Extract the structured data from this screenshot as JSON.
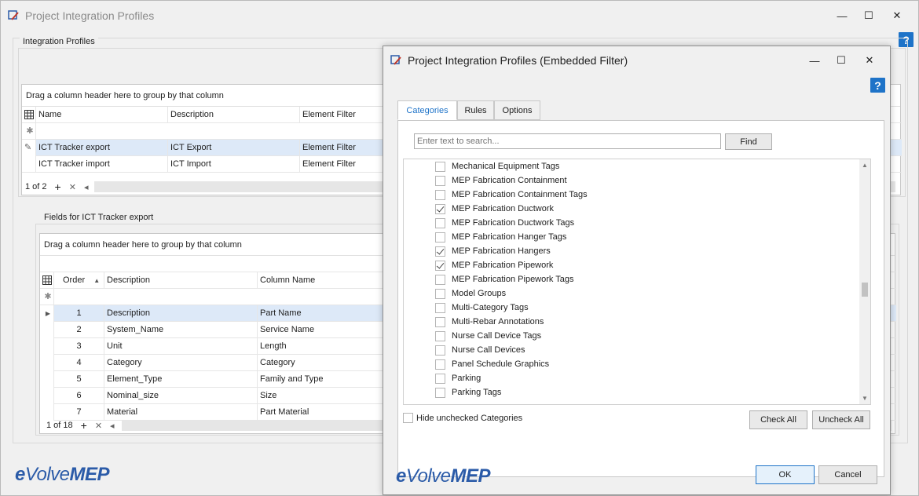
{
  "main_window": {
    "title": "Project Integration Profiles",
    "controls": {
      "minimize": "—",
      "maximize": "☐",
      "close": "✕"
    },
    "help": "?",
    "integration_profiles": {
      "group_label": "Integration Profiles",
      "group_panel_text": "Drag a column header here to group by that column",
      "columns": [
        "Name",
        "Description",
        "Element Filter"
      ],
      "rows": [
        {
          "name": "ICT Tracker export",
          "description": "ICT Export",
          "filter": "Element Filter"
        },
        {
          "name": "ICT Tracker import",
          "description": "ICT Import",
          "filter": "Element Filter"
        }
      ],
      "nav_text": "1 of 2",
      "nav_add": "+",
      "nav_delete": "✕",
      "nav_left": "◂"
    },
    "fields": {
      "group_label": "Fields for ICT Tracker export",
      "group_panel_text": "Drag a column header here to group by that column",
      "columns": [
        "Order",
        "Description",
        "Column Name"
      ],
      "rows": [
        {
          "order": "1",
          "description": "Description",
          "column": "Part Name"
        },
        {
          "order": "2",
          "description": "System_Name",
          "column": "Service Name"
        },
        {
          "order": "3",
          "description": "Unit",
          "column": "Length"
        },
        {
          "order": "4",
          "description": "Category",
          "column": "Category"
        },
        {
          "order": "5",
          "description": "Element_Type",
          "column": "Family and Type"
        },
        {
          "order": "6",
          "description": "Nominal_size",
          "column": "Size"
        },
        {
          "order": "7",
          "description": "Material",
          "column": "Part Material"
        }
      ],
      "nav_text": "1 of 18",
      "nav_add": "+",
      "nav_delete": "✕",
      "nav_left": "◂"
    },
    "logo": {
      "e": "e",
      "volve": "Volve",
      "mep": "MEP"
    }
  },
  "dialog": {
    "title": "Project Integration Profiles (Embedded Filter)",
    "controls": {
      "minimize": "—",
      "maximize": "☐",
      "close": "✕"
    },
    "help": "?",
    "tabs": [
      "Categories",
      "Rules",
      "Options"
    ],
    "search": {
      "placeholder": "Enter text to search...",
      "find_label": "Find"
    },
    "categories": [
      {
        "label": "Mechanical Equipment Tags",
        "checked": false
      },
      {
        "label": "MEP Fabrication Containment",
        "checked": false
      },
      {
        "label": "MEP Fabrication Containment Tags",
        "checked": false
      },
      {
        "label": "MEP Fabrication Ductwork",
        "checked": true
      },
      {
        "label": "MEP Fabrication Ductwork Tags",
        "checked": false
      },
      {
        "label": "MEP Fabrication Hanger Tags",
        "checked": false
      },
      {
        "label": "MEP Fabrication Hangers",
        "checked": true
      },
      {
        "label": "MEP Fabrication Pipework",
        "checked": true
      },
      {
        "label": "MEP Fabrication Pipework Tags",
        "checked": false
      },
      {
        "label": "Model Groups",
        "checked": false
      },
      {
        "label": "Multi-Category Tags",
        "checked": false
      },
      {
        "label": "Multi-Rebar Annotations",
        "checked": false
      },
      {
        "label": "Nurse Call Device Tags",
        "checked": false
      },
      {
        "label": "Nurse Call Devices",
        "checked": false
      },
      {
        "label": "Panel Schedule Graphics",
        "checked": false
      },
      {
        "label": "Parking",
        "checked": false
      },
      {
        "label": "Parking Tags",
        "checked": false
      }
    ],
    "hide_unchecked_label": "Hide unchecked Categories",
    "check_all_label": "Check All",
    "uncheck_all_label": "Uncheck All",
    "ok_label": "OK",
    "cancel_label": "Cancel",
    "logo": {
      "e": "e",
      "volve": "Volve",
      "mep": "MEP"
    }
  },
  "colors": {
    "accent": "#1e73c8",
    "selection": "#dde9f8",
    "logo": "#2b5ba8"
  }
}
